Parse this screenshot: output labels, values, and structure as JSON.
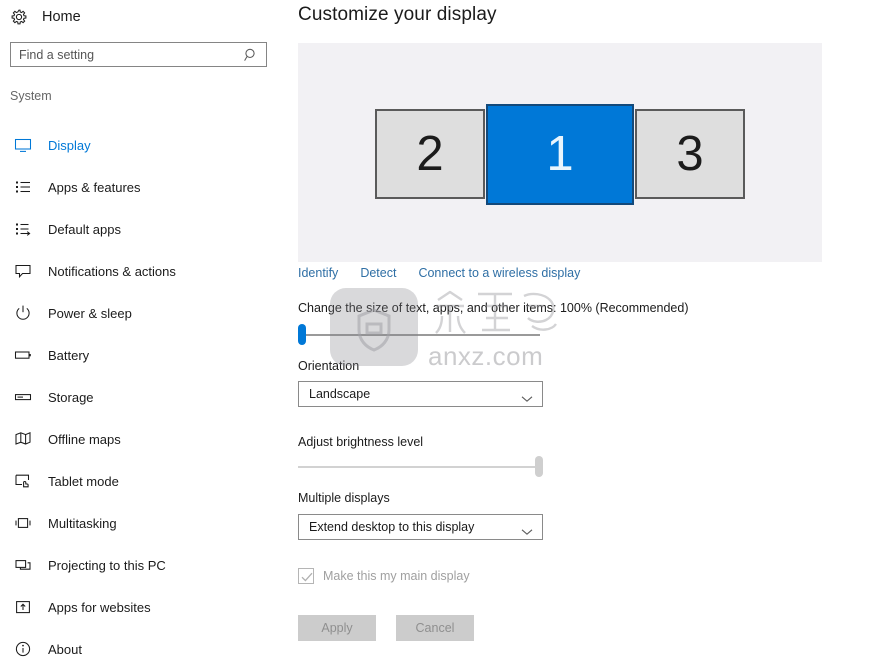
{
  "sidebar": {
    "home_label": "Home",
    "home_icon": "gear-icon",
    "search": {
      "placeholder": "Find a setting",
      "value": "",
      "icon": "search-icon"
    },
    "section_label": "System",
    "items": [
      {
        "label": "Display",
        "icon": "monitor-icon",
        "selected": true
      },
      {
        "label": "Apps & features",
        "icon": "list-icon",
        "selected": false
      },
      {
        "label": "Default apps",
        "icon": "list-arrow-icon",
        "selected": false
      },
      {
        "label": "Notifications & actions",
        "icon": "speech-bubble-icon",
        "selected": false
      },
      {
        "label": "Power & sleep",
        "icon": "power-icon",
        "selected": false
      },
      {
        "label": "Battery",
        "icon": "battery-icon",
        "selected": false
      },
      {
        "label": "Storage",
        "icon": "storage-icon",
        "selected": false
      },
      {
        "label": "Offline maps",
        "icon": "map-icon",
        "selected": false
      },
      {
        "label": "Tablet mode",
        "icon": "tablet-touch-icon",
        "selected": false
      },
      {
        "label": "Multitasking",
        "icon": "multitasking-icon",
        "selected": false
      },
      {
        "label": "Projecting to this PC",
        "icon": "project-screen-icon",
        "selected": false
      },
      {
        "label": "Apps for websites",
        "icon": "app-link-icon",
        "selected": false
      },
      {
        "label": "About",
        "icon": "info-icon",
        "selected": false
      }
    ]
  },
  "main": {
    "title": "Customize your display",
    "monitors": [
      {
        "number": "2",
        "active": false
      },
      {
        "number": "1",
        "active": true
      },
      {
        "number": "3",
        "active": false
      }
    ],
    "links": [
      {
        "label": "Identify"
      },
      {
        "label": "Detect"
      },
      {
        "label": "Connect to a wireless display"
      }
    ],
    "scaling": {
      "label": "Change the size of text, apps, and other items: 100% (Recommended)",
      "value_percent": 100,
      "slider_position": "min"
    },
    "orientation": {
      "label": "Orientation",
      "value": "Landscape",
      "chevron": "chevron-down-icon"
    },
    "brightness": {
      "label": "Adjust brightness level",
      "slider_position": "max",
      "disabled": true
    },
    "multiple_displays": {
      "label": "Multiple displays",
      "value": "Extend desktop to this display",
      "chevron": "chevron-down-icon"
    },
    "main_display_checkbox": {
      "label": "Make this my main display",
      "checked": true,
      "disabled": true
    },
    "buttons": {
      "apply_label": "Apply",
      "cancel_label": "Cancel",
      "disabled": true
    }
  },
  "watermark": {
    "domain_text": "anxz.com",
    "chinese_text": "安下载",
    "logo_icon": "shield-bag-icon"
  },
  "colors": {
    "accent": "#0078d7",
    "link": "#2f6fa5",
    "preview_bg": "#f2f1f4",
    "monitor_inactive": "#dedede",
    "button_disabled_bg": "#cccccc",
    "disabled_text": "#a0a0a0"
  }
}
